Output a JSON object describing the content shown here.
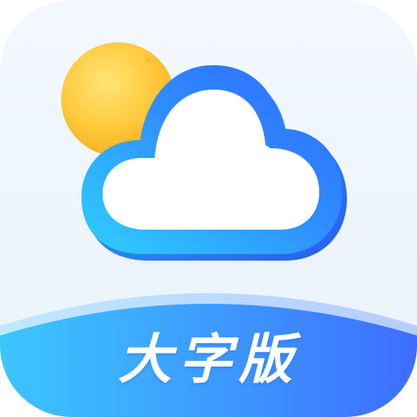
{
  "app_icon": {
    "label": "大字版",
    "symbols": {
      "sun": "sun-icon",
      "cloud": "cloud-icon"
    },
    "colors": {
      "background": "#eef5fd",
      "sun_light": "#ffe16a",
      "sun_dark": "#f5b21b",
      "cloud_light": "#32c7ff",
      "cloud_dark": "#2f6dff",
      "banner_light": "#35b7ff",
      "banner_dark": "#3d72ff",
      "label_text": "#ffffff"
    }
  }
}
